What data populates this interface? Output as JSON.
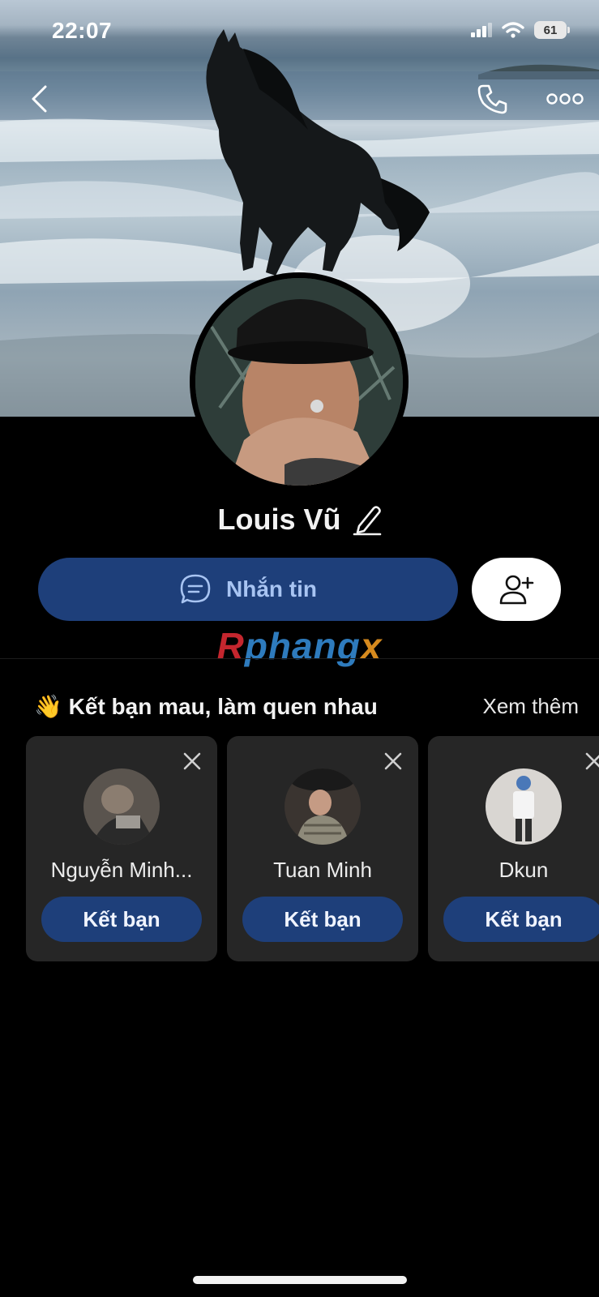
{
  "status_bar": {
    "time": "22:07",
    "battery": "61"
  },
  "profile": {
    "name": "Louis Vũ"
  },
  "actions": {
    "message_label": "Nhắn tin"
  },
  "watermark": {
    "part1": "R",
    "part2": "phang",
    "part3": "x"
  },
  "suggestions": {
    "title": "Kết bạn mau, làm quen nhau",
    "emoji": "👋",
    "see_more": "Xem thêm",
    "items": [
      {
        "name": "Nguyễn Minh...",
        "button": "Kết bạn"
      },
      {
        "name": "Tuan Minh",
        "button": "Kết bạn"
      },
      {
        "name": "Dkun",
        "button": "Kết bạn"
      }
    ]
  },
  "icons": {
    "back": "chevron-left-icon",
    "call": "phone-icon",
    "more": "more-dots-icon",
    "edit": "pencil-icon",
    "message": "chat-bubble-icon",
    "add_friend": "add-user-icon",
    "close": "close-icon"
  },
  "colors": {
    "background": "#000000",
    "primary_button": "#1e3f7a",
    "primary_text": "#a8c4f2",
    "card_bg": "#262626"
  }
}
